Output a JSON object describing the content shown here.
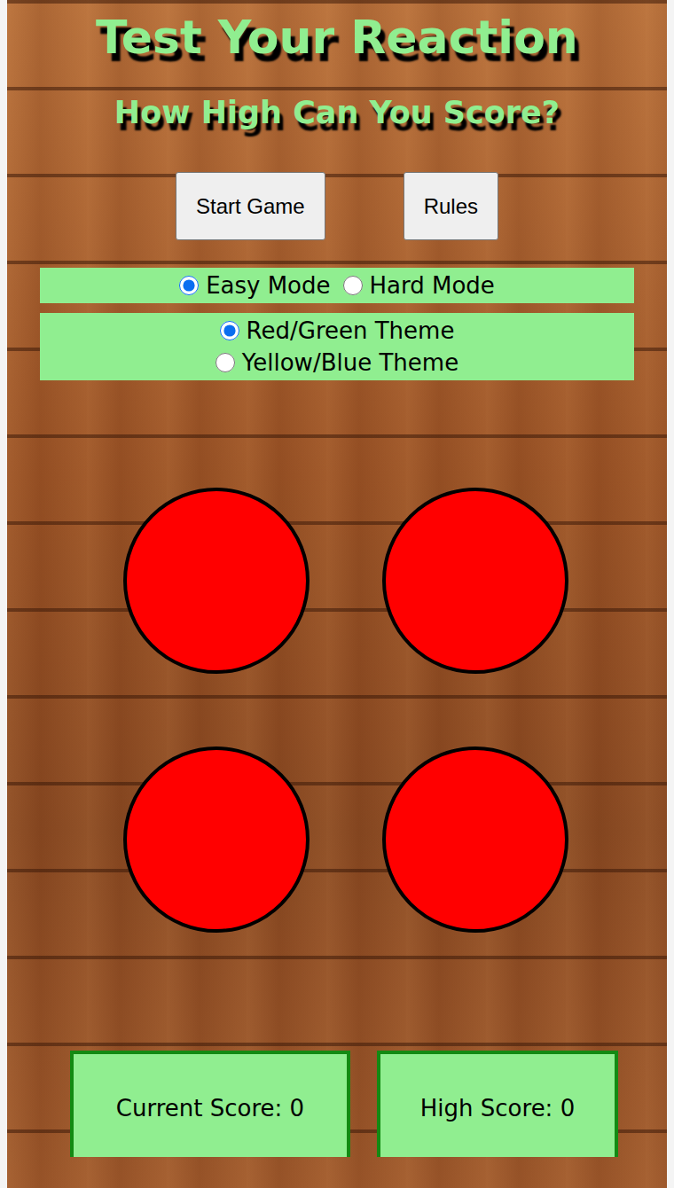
{
  "title": "Test Your Reaction",
  "subtitle": "How High Can You Score?",
  "buttons": [
    "Start Game",
    "Rules"
  ],
  "difficulty": [
    {
      "label": "Easy Mode",
      "selected": true
    },
    {
      "label": "Hard Mode",
      "selected": false
    }
  ],
  "theme": [
    {
      "label": "Red/Green Theme",
      "selected": true
    },
    {
      "label": "Yellow/Blue Theme",
      "selected": false
    }
  ],
  "circles": [
    {
      "lit": false
    },
    {
      "lit": false
    },
    {
      "lit": false
    },
    {
      "lit": false
    }
  ],
  "scores": [
    "Current Score: 0",
    "High Score: 0"
  ]
}
